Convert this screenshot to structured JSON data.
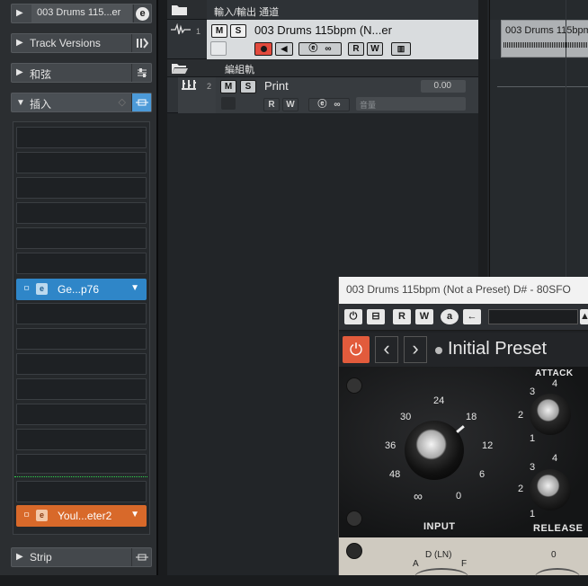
{
  "inspector": {
    "track_name": "003 Drums 115...er",
    "sections": {
      "track_versions": "Track Versions",
      "chords": "和弦",
      "inserts": "插入",
      "strip": "Strip"
    },
    "inserts": [
      {
        "name": "Ge...p76",
        "color": "#2f86c8"
      },
      {
        "name": "Youl...eter2",
        "color": "#d8692a"
      }
    ]
  },
  "tracks": {
    "io_channel": {
      "label": "輸入/輸出 通道"
    },
    "audio_track": {
      "number": "1",
      "name": "003 Drums 115bpm (N...er",
      "m": "M",
      "s": "S",
      "r": "R",
      "w": "W"
    },
    "group_header": {
      "label": "編組軌"
    },
    "group_track": {
      "number": "2",
      "name": "Print",
      "value": "0.00",
      "m": "M",
      "s": "S",
      "r": "R",
      "w": "W",
      "placeholder": "音量"
    }
  },
  "arrange": {
    "clip_name": "003 Drums 115bpm"
  },
  "plugin": {
    "title": "003 Drums 115bpm (Not a Preset) D# - 80SFO",
    "toolbar": {
      "r": "R",
      "w": "W",
      "a": "a"
    },
    "preset_name": "Initial Preset",
    "input": {
      "label": "INPUT",
      "scale": [
        "24",
        "30",
        "18",
        "36",
        "12",
        "48",
        "6",
        "∞",
        "0"
      ]
    },
    "attack": {
      "label": "ATTACK",
      "scale": [
        "4",
        "3",
        "2",
        "1"
      ]
    },
    "release": {
      "label": "RELEASE",
      "scale": [
        "4",
        "3",
        "2",
        "1"
      ]
    },
    "footer": {
      "d_label": "D (LN)",
      "a": "A",
      "f": "F",
      "zero": "0"
    }
  },
  "colors": {
    "record": "#e0322f",
    "power": "#e25b3c",
    "insert_blue": "#2f86c8",
    "insert_orange": "#d8692a",
    "divider_green": "#2fd64f"
  }
}
